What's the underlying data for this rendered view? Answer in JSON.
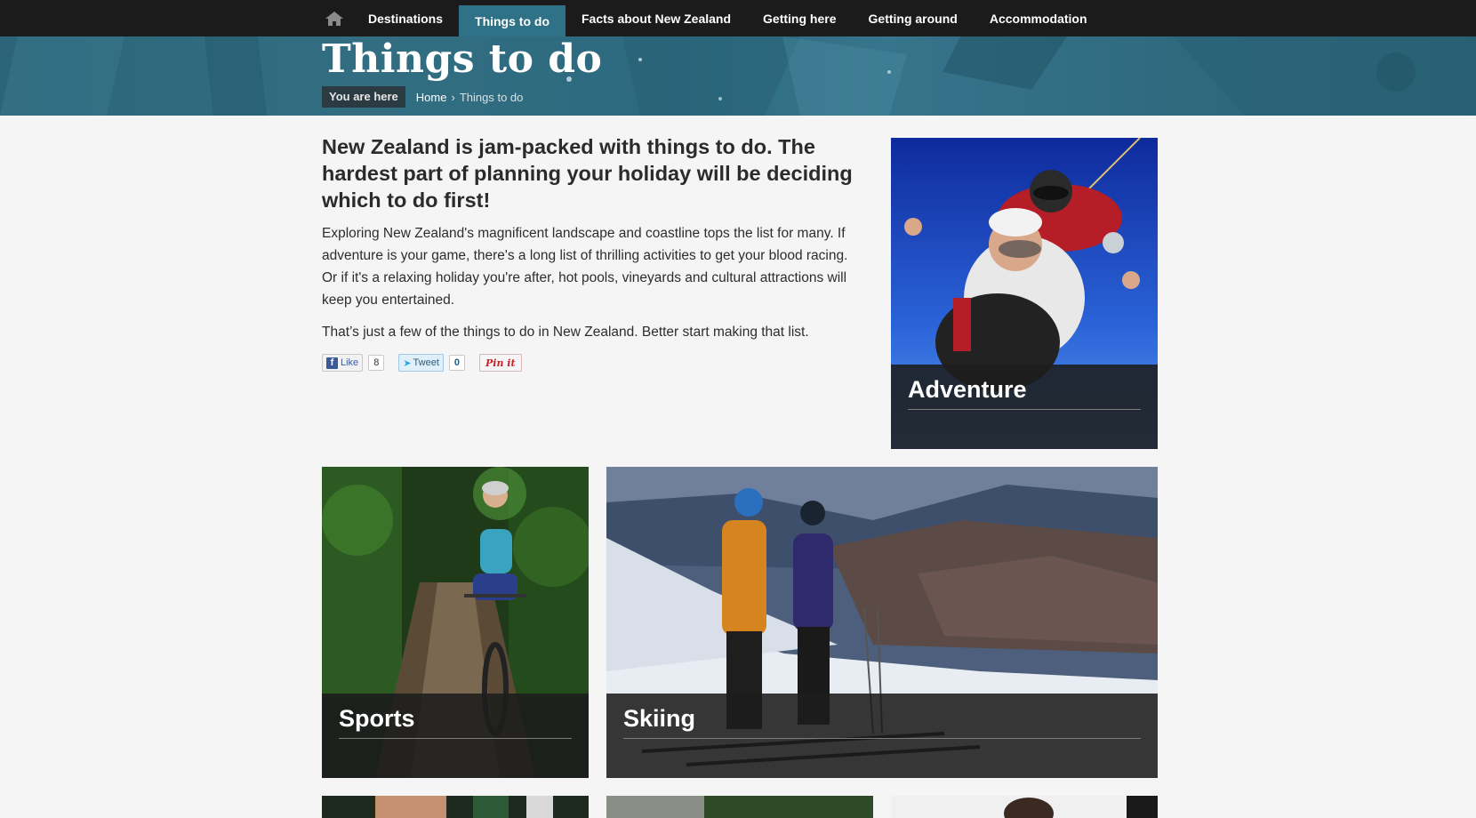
{
  "nav": {
    "home_icon": "home-icon",
    "items": [
      {
        "label": "Destinations"
      },
      {
        "label": "Things to do",
        "active": true
      },
      {
        "label": "Facts about New Zealand"
      },
      {
        "label": "Getting here"
      },
      {
        "label": "Getting around"
      },
      {
        "label": "Accommodation"
      }
    ]
  },
  "hero": {
    "title": "Things to do"
  },
  "breadcrumb": {
    "label": "You are here",
    "home": "Home",
    "separator": "›",
    "current": "Things to do"
  },
  "intro": {
    "heading": "New Zealand is jam-packed with things to do. The hardest part of planning your holiday will be deciding which to do first!",
    "paragraph1": "Exploring New Zealand's magnificent landscape and coastline tops the list for many. If adventure is your game, there's a long list of thrilling activities to get your blood racing. Or if it's a relaxing holiday you're after, hot pools, vineyards and cultural attractions will keep you entertained.",
    "paragraph2": "That’s just a few of the things to do in New Zealand. Better start making that list."
  },
  "social": {
    "like_label": "Like",
    "like_count": "8",
    "tweet_label": "Tweet",
    "tweet_count": "0",
    "pin_label": "Pin it"
  },
  "cards": {
    "adventure": {
      "title": "Adventure"
    },
    "sports": {
      "title": "Sports"
    },
    "skiing": {
      "title": "Skiing"
    }
  },
  "colors": {
    "nav_bg": "#1b1b1b",
    "nav_active": "#2f7186",
    "hero_teal": "#2e6b80",
    "page_bg": "#f5f5f5",
    "caption_bg": "#1c1c1c"
  }
}
